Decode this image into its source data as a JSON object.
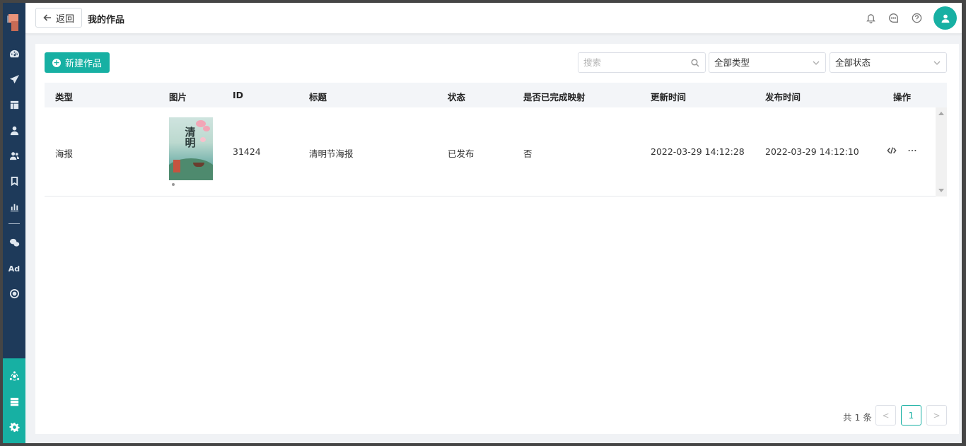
{
  "header": {
    "back_label": "返回",
    "page_title": "我的作品"
  },
  "toolbar": {
    "new_button_label": "新建作品",
    "search_placeholder": "搜索",
    "type_filter_value": "全部类型",
    "status_filter_value": "全部状态"
  },
  "table": {
    "columns": [
      "类型",
      "图片",
      "ID",
      "标题",
      "状态",
      "是否已完成映射",
      "更新时间",
      "发布时间",
      "操作"
    ],
    "rows": [
      {
        "type": "海报",
        "id": "31424",
        "title": "清明节海报",
        "status": "已发布",
        "mapped": "否",
        "updated_at": "2022-03-29 14:12:28",
        "published_at": "2022-03-29 14:12:10",
        "poster_text": "清明"
      }
    ]
  },
  "pagination": {
    "total_label": "共 1 条",
    "current_page": "1",
    "prev_label": "<",
    "next_label": ">"
  },
  "sidebar": {
    "ad_label": "Ad"
  },
  "colors": {
    "accent": "#17b0a3",
    "sidebar": "#1e3a5a"
  }
}
